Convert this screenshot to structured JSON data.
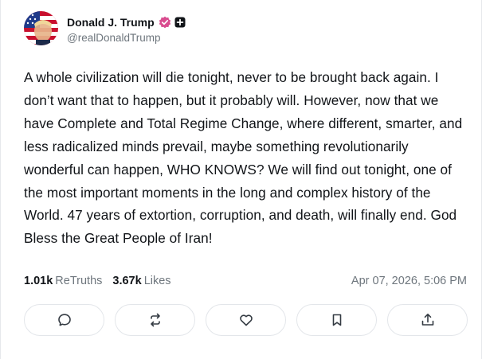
{
  "author": {
    "display_name": "Donald J. Trump",
    "handle": "@realDonaldTrump",
    "verified_color": "#d94c8f"
  },
  "post": {
    "text": "A whole civilization will die tonight, never to be brought back again. I don’t want that to happen, but it probably will. However, now that we have Complete and Total Regime Change, where different, smarter, and less radicalized minds prevail, maybe something revolutionarily wonderful can happen, WHO KNOWS? We will find out tonight, one of the most important moments in the long and complex history of the World. 47 years of extortion, corruption, and death, will finally end. God Bless the Great People of Iran!"
  },
  "stats": {
    "retruths_count": "1.01k",
    "retruths_label": "ReTruths",
    "likes_count": "3.67k",
    "likes_label": "Likes"
  },
  "timestamp": "Apr 07, 2026, 5:06 PM",
  "actions": [
    {
      "icon": "comment-icon"
    },
    {
      "icon": "retruth-icon"
    },
    {
      "icon": "heart-icon"
    },
    {
      "icon": "bookmark-icon"
    },
    {
      "icon": "share-icon"
    }
  ]
}
